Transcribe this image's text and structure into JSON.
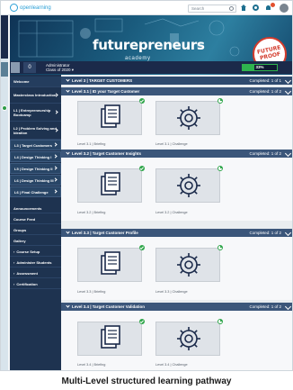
{
  "app": {
    "brand": "openlearning"
  },
  "search": {
    "placeholder": "Search"
  },
  "banner": {
    "brand": "futurepreneurs",
    "subtitle": "academy",
    "seal_text": "FUTURE PROOF"
  },
  "user": {
    "level": "0",
    "name_line1": "Administrator",
    "name_line2": "Class of 2020 ▾",
    "progress_percent": 33,
    "progress_text": "33%"
  },
  "sidebar": {
    "items": [
      {
        "label": "Welcome"
      },
      {
        "label": "Masterclass Introduction"
      },
      {
        "label": "L1 | Entrepreneurship Bootcamp"
      },
      {
        "label": "L2 | Problem Solving and Ideation"
      },
      {
        "label": "L3 | Target Customers"
      },
      {
        "label": "L4 | Design Thinking I"
      },
      {
        "label": "L5 | Design Thinking II"
      },
      {
        "label": "L6 | Design Thinking III"
      },
      {
        "label": "L6 | Final Challenge"
      },
      {
        "label": "Announcements"
      },
      {
        "label": "Course Feed"
      },
      {
        "label": "Groups"
      },
      {
        "label": "Gallery"
      },
      {
        "label": "Course Setup"
      },
      {
        "label": "Administer Students"
      },
      {
        "label": "Assessment"
      },
      {
        "label": "Certification"
      }
    ]
  },
  "main": {
    "header": {
      "title": "Level 3 | TARGET CUSTOMERS",
      "completed": "Completed: 1 of 1"
    },
    "sections": [
      {
        "title": "Level 3.1 | ID your Target Customer",
        "completed": "Completed: 1 of 2",
        "cards": [
          {
            "label": "Level 3.1 | Briefing",
            "status": "complete"
          },
          {
            "label": "Level 3.1 | Challenge",
            "status": "partial"
          }
        ]
      },
      {
        "title": "Level 3.2 | Target Customer Insights",
        "completed": "Completed: 1 of 2",
        "cards": [
          {
            "label": "Level 3.2 | Briefing",
            "status": "complete"
          },
          {
            "label": "Level 3.2 | Challenge",
            "status": "partial"
          }
        ]
      },
      {
        "title": "Level 3.3 | Target Customer Profile",
        "completed": "Completed: 1 of 2",
        "cards": [
          {
            "label": "Level 3.3 | Briefing",
            "status": "complete"
          },
          {
            "label": "Level 3.3 | Challenge",
            "status": "partial"
          }
        ]
      },
      {
        "title": "Level 3.4 | Target Customer Validation",
        "completed": "Completed: 1 of 2",
        "cards": [
          {
            "label": "Level 3.4 | Briefing",
            "status": "complete"
          },
          {
            "label": "Level 3.4 | Challenge",
            "status": "partial"
          }
        ]
      }
    ]
  },
  "caption": "Multi-Level structured learning pathway",
  "colors": {
    "navy": "#1b2a4a",
    "sidebar": "#1e3350",
    "level_bar": "#3b567a",
    "accent_green": "#2fa64a",
    "brand_blue": "#2a9fd6"
  }
}
